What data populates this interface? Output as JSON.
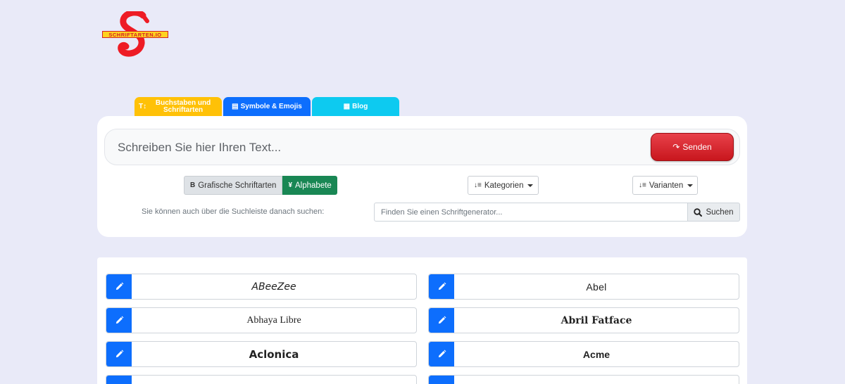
{
  "logo": {
    "letter": "S",
    "text": "SCHRIFTARTEN.IO"
  },
  "tabs": [
    {
      "icon": "text-height-icon",
      "glyph": "T↕",
      "label": "Buchstaben und Schriftarten"
    },
    {
      "icon": "sticky-note-icon",
      "glyph": "▤",
      "label": "Symbole & Emojis"
    },
    {
      "icon": "newspaper-icon",
      "glyph": "▦",
      "label": "Blog"
    }
  ],
  "input": {
    "placeholder": "Schreiben Sie hier Ihren Text...",
    "send_label": "Senden",
    "send_glyph": "↷"
  },
  "toggle": {
    "graphic": {
      "glyph": "B",
      "label": "Grafische Schriftarten"
    },
    "alphabet": {
      "glyph": "¥",
      "label": "Alphabete"
    }
  },
  "dropdowns": {
    "categories": {
      "glyph": "↓≡",
      "label": "Kategorien"
    },
    "variants": {
      "glyph": "↓≡",
      "label": "Varianten"
    }
  },
  "search": {
    "hint": "Sie können auch über die Suchleiste danach suchen:",
    "placeholder": "Finden Sie einen Schriftgenerator...",
    "button": "Suchen"
  },
  "fonts": [
    {
      "name": "ABeeZee"
    },
    {
      "name": "Abel"
    },
    {
      "name": "Abhaya Libre"
    },
    {
      "name": "Abril Fatface"
    },
    {
      "name": "Aclonica"
    },
    {
      "name": "Acme"
    },
    {
      "name": ""
    },
    {
      "name": ""
    }
  ],
  "colors": {
    "background": "#e9eaf8",
    "tab_yellow": "#ffc107",
    "tab_blue": "#0d6efd",
    "tab_cyan": "#0dcaf0",
    "send_red": "#d92027",
    "alphabet_green": "#198754",
    "edit_blue": "#0d6efd"
  }
}
